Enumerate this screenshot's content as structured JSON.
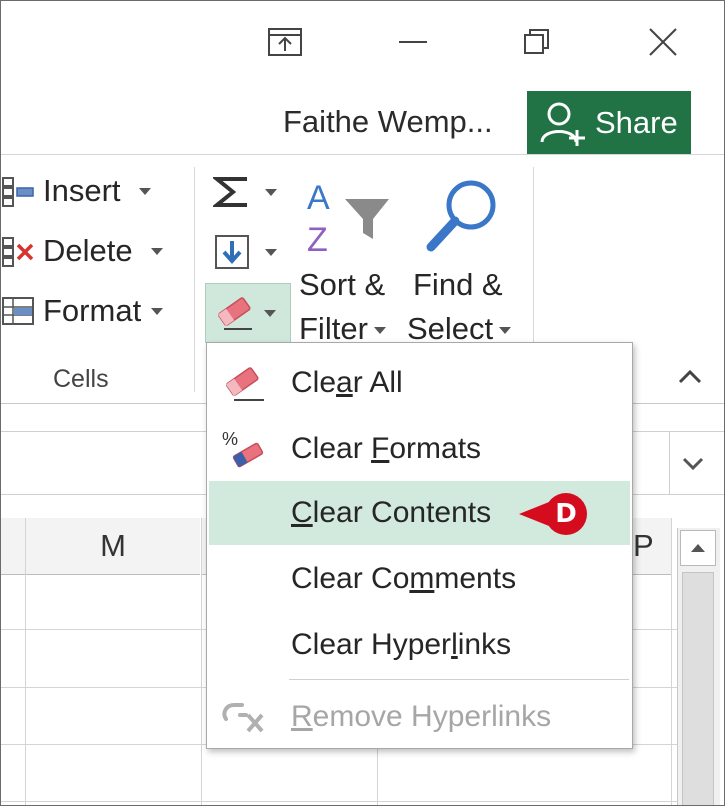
{
  "titlebar": {
    "user_name": "Faithe Wemp...",
    "share_label": "Share"
  },
  "ribbon": {
    "cells_group": {
      "insert_label": "Insert",
      "delete_label": "Delete",
      "format_label": "Format",
      "group_label": "Cells"
    },
    "editing_group": {
      "sort_filter_line1": "Sort &",
      "sort_filter_line2": "Filter",
      "find_select_line1": "Find &",
      "find_select_line2": "Select"
    }
  },
  "grid": {
    "columns": [
      "M",
      "P"
    ]
  },
  "clear_menu": {
    "items": [
      {
        "pre": "Cle",
        "ul": "a",
        "post": "r All"
      },
      {
        "pre": "Clear ",
        "ul": "F",
        "post": "ormats"
      },
      {
        "pre": "",
        "ul": "C",
        "post": "lear Contents"
      },
      {
        "pre": "Clear Co",
        "ul": "m",
        "post": "ments"
      },
      {
        "pre": "Clear Hyper",
        "ul": "l",
        "post": "inks"
      },
      {
        "pre": "",
        "ul": "R",
        "post": "emove Hyperlinks"
      }
    ]
  },
  "callout": {
    "label": "D"
  },
  "colors": {
    "share_green": "#217346",
    "hover_green": "#d2e9dd",
    "callout_red": "#d40c1e",
    "eraser_pink": "#e8737f"
  },
  "icons": [
    "popout-icon",
    "minimize-icon",
    "restore-icon",
    "close-icon",
    "add-person-icon",
    "insert-cells-icon",
    "delete-cells-icon",
    "format-cells-icon",
    "autosum-icon",
    "fill-icon",
    "eraser-icon",
    "sort-az-filter-icon",
    "magnifier-icon",
    "chevron-up-icon",
    "chevron-down-icon",
    "percent-eraser-icon",
    "broken-link-icon"
  ]
}
